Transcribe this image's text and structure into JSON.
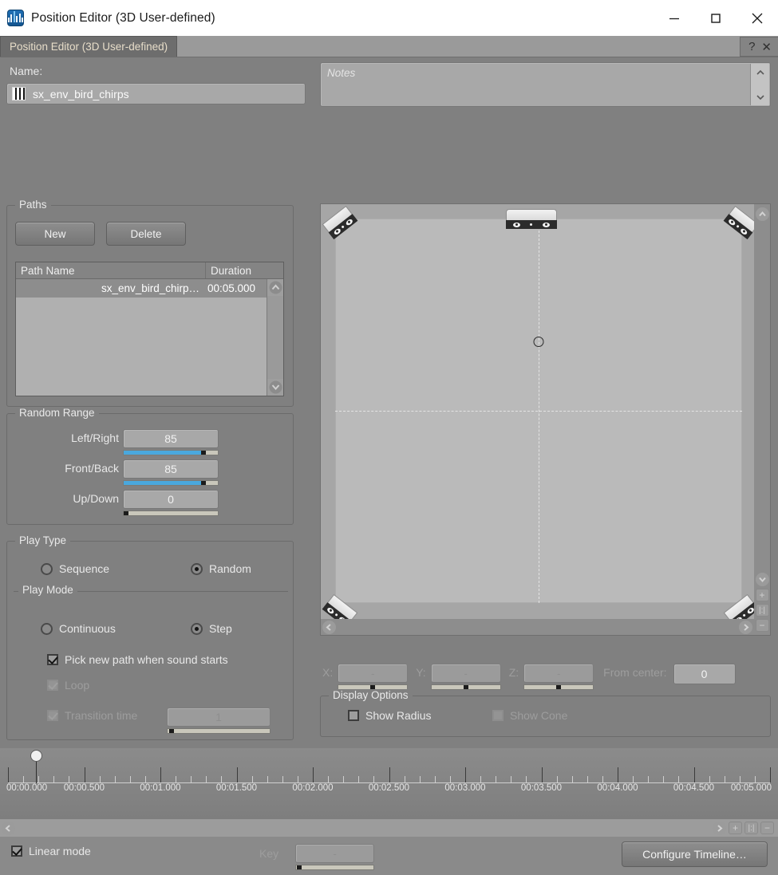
{
  "window": {
    "title": "Position Editor (3D User-defined)",
    "icon": "audio-waveform-icon",
    "minimize": "minimize-icon",
    "maximize": "maximize-icon",
    "close": "close-icon"
  },
  "tabstrip": {
    "tabs": [
      {
        "label": "Position Editor (3D User-defined)",
        "active": true
      }
    ],
    "help_label": "?",
    "close_label": "✕"
  },
  "name_section": {
    "label": "Name:",
    "icon": "grid-object-icon",
    "value": "sx_env_bird_chirps"
  },
  "notes": {
    "placeholder": "Notes",
    "value": "",
    "scroll_up": "chevron-up-icon",
    "scroll_down": "chevron-down-icon"
  },
  "paths": {
    "legend": "Paths",
    "new_label": "New",
    "delete_label": "Delete",
    "columns": [
      "Path Name",
      "Duration"
    ],
    "rows": [
      {
        "name": "sx_env_bird_chirp…",
        "duration": "00:05.000",
        "selected": true
      }
    ]
  },
  "random_range": {
    "legend": "Random Range",
    "items": [
      {
        "label": "Left/Right",
        "value": "85",
        "percent": 85
      },
      {
        "label": "Front/Back",
        "value": "85",
        "percent": 85
      },
      {
        "label": "Up/Down",
        "value": "0",
        "percent": 0
      }
    ]
  },
  "play_type": {
    "legend": "Play Type",
    "options": [
      {
        "label": "Sequence",
        "selected": false
      },
      {
        "label": "Random",
        "selected": true
      }
    ]
  },
  "play_mode": {
    "legend": "Play Mode",
    "options": [
      {
        "label": "Continuous",
        "selected": false
      },
      {
        "label": "Step",
        "selected": true
      }
    ],
    "pick_new_path": {
      "label": "Pick new path when sound starts",
      "checked": true,
      "enabled": true
    },
    "loop": {
      "label": "Loop",
      "checked": true,
      "enabled": false
    },
    "transition_time": {
      "label": "Transition time",
      "checked": true,
      "enabled": false,
      "value": "1",
      "percent": 4
    }
  },
  "viewport": {
    "speakers": [
      "speaker-top-left",
      "speaker-top-center",
      "speaker-top-right",
      "speaker-bottom-left",
      "speaker-bottom-right"
    ],
    "listener": "listener-position-marker",
    "controls": {
      "collapse_up": "chevron-up-icon",
      "collapse_down": "chevron-down-icon",
      "zoom_in": "+",
      "zoom_reset": "|:|",
      "zoom_out": "−",
      "pan_left": "chevron-left-icon",
      "pan_right": "chevron-right-icon"
    }
  },
  "coords": {
    "x": {
      "label": "X:",
      "value": "-",
      "percent": 50
    },
    "y": {
      "label": "Y:",
      "value": "-",
      "percent": 50
    },
    "z": {
      "label": "Z:",
      "value": "-",
      "percent": 50
    },
    "from_center": {
      "label": "From center:",
      "value": "0"
    }
  },
  "display_options": {
    "legend": "Display Options",
    "show_radius": {
      "label": "Show Radius",
      "checked": false,
      "enabled": true
    },
    "show_cone": {
      "label": "Show Cone",
      "checked": false,
      "enabled": false
    }
  },
  "timeline": {
    "labels": [
      "00:00.000",
      "00:00.500",
      "00:01.000",
      "00:01.500",
      "00:02.000",
      "00:02.500",
      "00:03.000",
      "00:03.500",
      "00:04.000",
      "00:04.500",
      "00:05.000"
    ],
    "playhead_time": "00:00.000",
    "playhead_percent": 0,
    "major_ticks": 11,
    "minor_per_major": 5,
    "scroll_left": "chevron-left-icon",
    "scroll_right": "chevron-right-icon",
    "zoom_in": "+",
    "zoom_reset": "|:|",
    "zoom_out": "−"
  },
  "footer": {
    "linear_mode": {
      "label": "Linear mode",
      "checked": true
    },
    "key": {
      "label": "Key",
      "value": "-",
      "percent": 2
    },
    "configure_timeline": "Configure Timeline…"
  },
  "colors": {
    "panel_bg": "#808080",
    "viewport_bg": "#bababa",
    "slider_fill": "#4aa8dd",
    "titlebar_bg": "#ffffff",
    "tab_text": "#e7ddc9"
  }
}
